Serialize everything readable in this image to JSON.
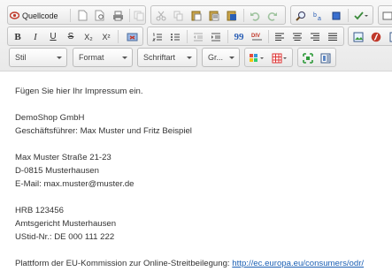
{
  "toolbar": {
    "source_label": "Quellcode",
    "style_combo": "Stil",
    "format_combo": "Format",
    "font_combo": "Schriftart",
    "size_combo": "Gr...",
    "bold": "B",
    "italic": "I",
    "underline": "U",
    "strike": "S",
    "subscript": "X₂",
    "superscript": "X²",
    "blockquote": "99"
  },
  "content": {
    "intro": "Fügen Sie hier Ihr Impressum ein.",
    "company": "DemoShop GmbH",
    "ceo": "Geschäftsführer: Max Muster und Fritz Beispiel",
    "street": "Max Muster Straße 21-23",
    "city": "D-0815 Musterhausen",
    "email": "E-Mail: max.muster@muster.de",
    "hrb": "HRB 123456",
    "court": "Amtsgericht Musterhausen",
    "vat": "UStid-Nr.: DE 000 111 222",
    "platform_text": "Plattform der EU-Kommission zur Online-Streitbeilegung: ",
    "platform_link": "http://ec.europa.eu/consumers/odr/"
  }
}
